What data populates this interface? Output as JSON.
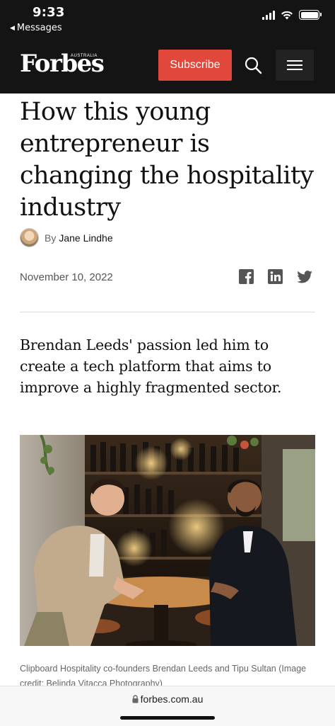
{
  "status_bar": {
    "time": "9:33",
    "back_label": "Messages"
  },
  "header": {
    "logo": "Forbes",
    "logo_edition": "AUSTRALIA",
    "subscribe_label": "Subscribe"
  },
  "article": {
    "title": "How this young entrepreneur is changing the hospitality industry",
    "byline_prefix": "By",
    "author": "Jane Lindhe",
    "date": "November 10, 2022",
    "dek": "Brendan Leeds' passion led him to create a tech platform that aims to improve a highly fragmented sector.",
    "caption": "Clipboard Hospitality co-founders Brendan Leeds and Tipu Sultan (Image credit: Belinda Vitacca Photography)"
  },
  "browser": {
    "url": "forbes.com.au"
  },
  "colors": {
    "header_bg": "#141414",
    "subscribe_bg": "#e0483c"
  },
  "icons": [
    "signal-icon",
    "wifi-icon",
    "battery-icon",
    "search-icon",
    "hamburger-menu-icon",
    "facebook-icon",
    "linkedin-icon",
    "twitter-icon",
    "lock-icon"
  ]
}
